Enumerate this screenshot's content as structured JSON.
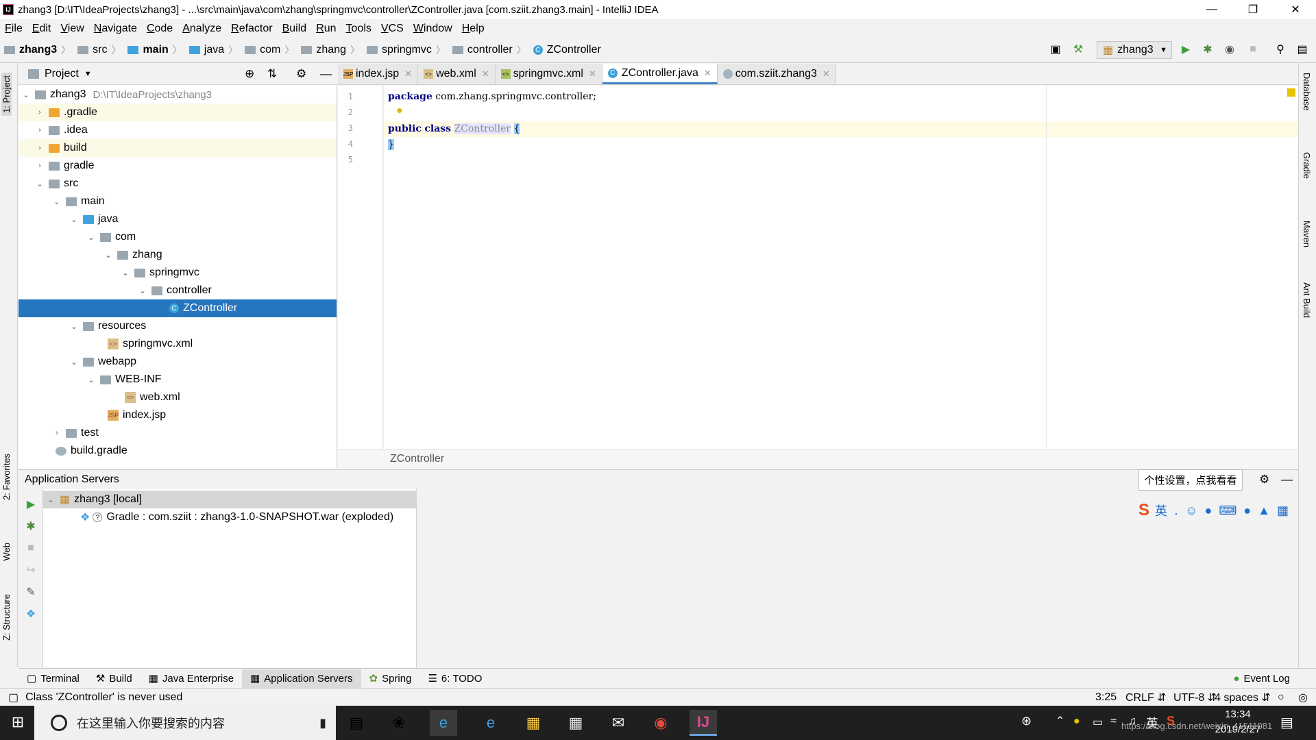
{
  "window": {
    "title": "zhang3 [D:\\IT\\IdeaProjects\\zhang3] - ...\\src\\main\\java\\com\\zhang\\springmvc\\controller\\ZController.java [com.sziit.zhang3.main] - IntelliJ IDEA",
    "app_icon": "IJ"
  },
  "menu": [
    "File",
    "Edit",
    "View",
    "Navigate",
    "Code",
    "Analyze",
    "Refactor",
    "Build",
    "Run",
    "Tools",
    "VCS",
    "Window",
    "Help"
  ],
  "navbar": {
    "crumbs": [
      "zhang3",
      "src",
      "main",
      "java",
      "com",
      "zhang",
      "springmvc",
      "controller",
      "ZController"
    ],
    "run_config": "zhang3"
  },
  "project": {
    "header": "Project",
    "tree": [
      {
        "label": "zhang3",
        "path": "D:\\IT\\IdeaProjects\\zhang3"
      },
      {
        "label": ".gradle"
      },
      {
        "label": ".idea"
      },
      {
        "label": "build"
      },
      {
        "label": "gradle"
      },
      {
        "label": "src"
      },
      {
        "label": "main"
      },
      {
        "label": "java"
      },
      {
        "label": "com"
      },
      {
        "label": "zhang"
      },
      {
        "label": "springmvc"
      },
      {
        "label": "controller"
      },
      {
        "label": "ZController"
      },
      {
        "label": "resources"
      },
      {
        "label": "springmvc.xml"
      },
      {
        "label": "webapp"
      },
      {
        "label": "WEB-INF"
      },
      {
        "label": "web.xml"
      },
      {
        "label": "index.jsp"
      },
      {
        "label": "test"
      },
      {
        "label": "build.gradle"
      }
    ]
  },
  "editor": {
    "tabs": [
      "index.jsp",
      "web.xml",
      "springmvc.xml",
      "ZController.java",
      "com.sziit.zhang3"
    ],
    "line_numbers": [
      "1",
      "2",
      "3",
      "4",
      "5"
    ],
    "code": {
      "l1_kw": "package",
      "l1_rest": " com.zhang.springmvc.controller;",
      "l3_kw1": "public",
      "l3_kw2": "class",
      "l3_cls": "ZController",
      "l3_brace": "{",
      "l4": "}"
    },
    "breadcrumb": "ZController"
  },
  "app_servers": {
    "header": "Application Servers",
    "server": "zhang3 [local]",
    "artifact": "Gradle : com.sziit : zhang3-1.0-SNAPSHOT.war (exploded)"
  },
  "tooltip": "个性设置，点我看看",
  "ime": {
    "lang": "英"
  },
  "left_tabs": [
    "1: Project",
    "2: Favorites",
    "Web",
    "Z: Structure"
  ],
  "right_tabs": [
    "Database",
    "Gradle",
    "Maven",
    "Ant Build"
  ],
  "bottom_tabs": [
    "Terminal",
    "Build",
    "Java Enterprise",
    "Application Servers",
    "Spring",
    "6: TODO"
  ],
  "event_log": "Event Log",
  "status": {
    "message": "Class 'ZController' is never used",
    "position": "3:25",
    "line_sep": "CRLF",
    "encoding": "UTF-8",
    "indent": "4 spaces"
  },
  "taskbar": {
    "search_placeholder": "在这里输入你要搜索的内容",
    "time": "13:34",
    "date": "2019/2/27",
    "lang": "英",
    "watermark": "https://blog.csdn.net/weixin_41511081"
  }
}
